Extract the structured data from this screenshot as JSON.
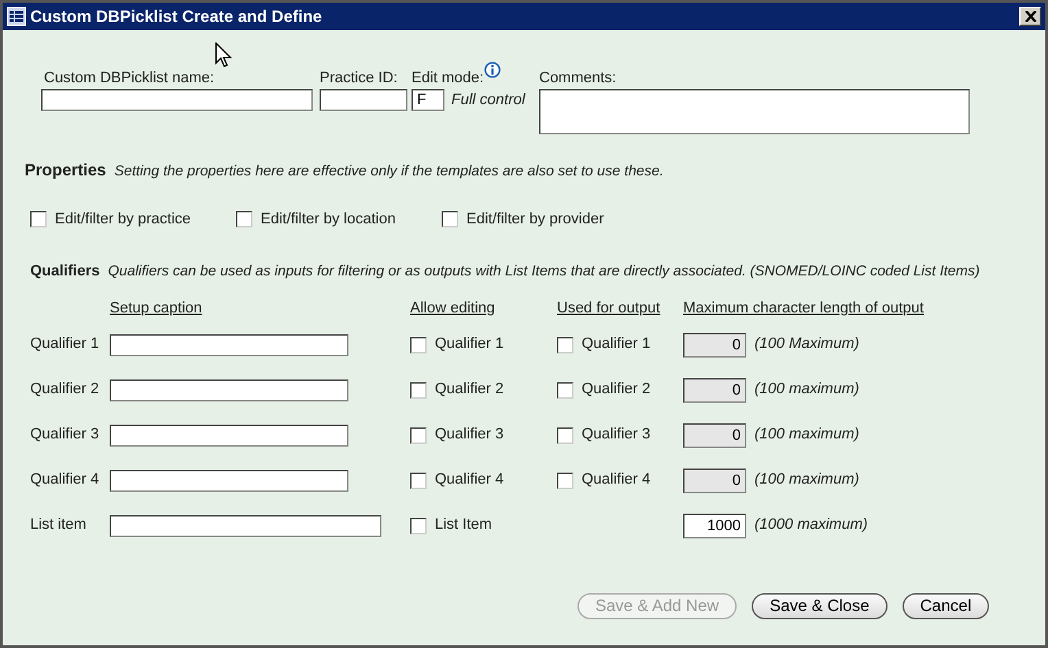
{
  "window": {
    "title": "Custom DBPicklist Create and Define"
  },
  "header_fields": {
    "name": {
      "label": "Custom DBPicklist name:"
    },
    "practice_id": {
      "label": "Practice ID:"
    },
    "edit_mode": {
      "label": "Edit mode:",
      "value": "F",
      "note": "Full control"
    },
    "comments": {
      "label": "Comments:"
    }
  },
  "properties": {
    "title": "Properties",
    "description": "Setting the properties here are effective only if the templates are also set to use these.",
    "options": [
      {
        "label": "Edit/filter by practice",
        "checked": false
      },
      {
        "label": "Edit/filter by location",
        "checked": false
      },
      {
        "label": "Edit/filter by provider",
        "checked": false
      }
    ]
  },
  "qualifiers": {
    "title": "Qualifiers",
    "description": "Qualifiers can be used as inputs for filtering or as outputs with List Items that are directly associated. (SNOMED/LOINC coded List Items)",
    "columns": [
      "Setup caption",
      "Allow editing",
      "Used for output",
      "Maximum character length of output"
    ],
    "rows": [
      {
        "label": "Qualifier 1",
        "allow_editing": {
          "label": "Qualifier 1",
          "checked": false
        },
        "used_for_output": {
          "label": "Qualifier 1",
          "checked": false
        },
        "max_length": {
          "value": "0",
          "note": "(100 Maximum)",
          "disabled": true
        }
      },
      {
        "label": "Qualifier 2",
        "allow_editing": {
          "label": "Qualifier 2",
          "checked": false
        },
        "used_for_output": {
          "label": "Qualifier 2",
          "checked": false
        },
        "max_length": {
          "value": "0",
          "note": "(100 maximum)",
          "disabled": true
        }
      },
      {
        "label": "Qualifier 3",
        "allow_editing": {
          "label": "Qualifier 3",
          "checked": false
        },
        "used_for_output": {
          "label": "Qualifier 3",
          "checked": false
        },
        "max_length": {
          "value": "0",
          "note": "(100 maximum)",
          "disabled": true
        }
      },
      {
        "label": "Qualifier 4",
        "allow_editing": {
          "label": "Qualifier 4",
          "checked": false
        },
        "used_for_output": {
          "label": "Qualifier 4",
          "checked": false
        },
        "max_length": {
          "value": "0",
          "note": "(100 maximum)",
          "disabled": true
        }
      },
      {
        "label": "List item",
        "allow_editing": {
          "label": "List Item",
          "checked": false
        },
        "max_length": {
          "value": "1000",
          "note": "(1000 maximum)",
          "disabled": false
        }
      }
    ]
  },
  "buttons": [
    {
      "label": "Save & Add New",
      "disabled": true
    },
    {
      "label": "Save & Close",
      "disabled": false
    },
    {
      "label": "Cancel",
      "disabled": false
    }
  ]
}
